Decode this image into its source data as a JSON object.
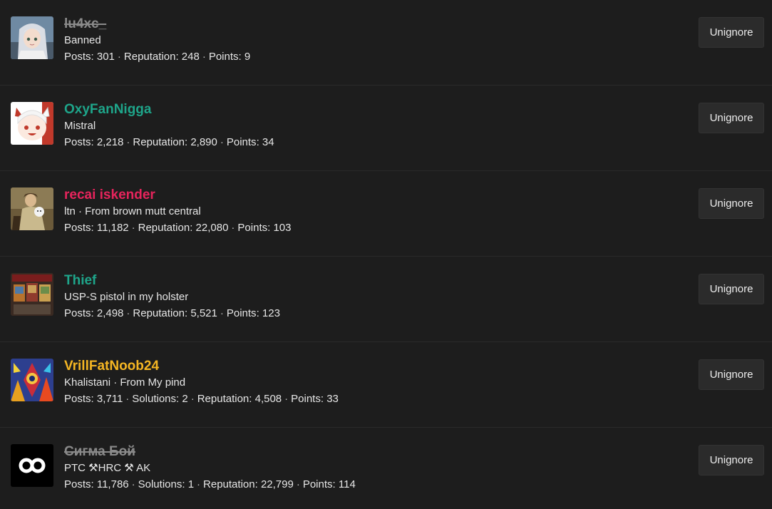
{
  "users": [
    {
      "name": "lu4xc_",
      "banned": true,
      "color": "#8a8a8a",
      "title": "Banned",
      "stats": [
        {
          "label": "Posts",
          "value": "301"
        },
        {
          "label": "Reputation",
          "value": "248"
        },
        {
          "label": "Points",
          "value": "9"
        }
      ],
      "button": "Unignore",
      "avatar": "anime-girl-avatar"
    },
    {
      "name": "OxyFanNigga",
      "banned": false,
      "color": "#1ea58a",
      "title": "Mistral",
      "stats": [
        {
          "label": "Posts",
          "value": "2,218"
        },
        {
          "label": "Reputation",
          "value": "2,890"
        },
        {
          "label": "Points",
          "value": "34"
        }
      ],
      "button": "Unignore",
      "avatar": "anime-character-avatar"
    },
    {
      "name": "recai iskender",
      "banned": false,
      "color": "#e6245c",
      "title": "ltn · From brown mutt central",
      "stats": [
        {
          "label": "Posts",
          "value": "11,182"
        },
        {
          "label": "Reputation",
          "value": "22,080"
        },
        {
          "label": "Points",
          "value": "103"
        }
      ],
      "button": "Unignore",
      "avatar": "painting-avatar"
    },
    {
      "name": "Thief",
      "banned": false,
      "color": "#1ea58a",
      "title": "USP-S pistol in my holster",
      "stats": [
        {
          "label": "Posts",
          "value": "2,498"
        },
        {
          "label": "Reputation",
          "value": "5,521"
        },
        {
          "label": "Points",
          "value": "123"
        }
      ],
      "button": "Unignore",
      "avatar": "cards-avatar"
    },
    {
      "name": "VrillFatNoob24",
      "banned": false,
      "color": "#f5b623",
      "title": "Khalistani · From My pind",
      "stats": [
        {
          "label": "Posts",
          "value": "3,711"
        },
        {
          "label": "Solutions",
          "value": "2"
        },
        {
          "label": "Reputation",
          "value": "4,508"
        },
        {
          "label": "Points",
          "value": "33"
        }
      ],
      "button": "Unignore",
      "avatar": "colorful-art-avatar"
    },
    {
      "name": "Сигма Бой",
      "banned": true,
      "color": "#8a8a8a",
      "title": "PTC ⚒HRC ⚒ AK",
      "stats": [
        {
          "label": "Posts",
          "value": "11,786"
        },
        {
          "label": "Solutions",
          "value": "1"
        },
        {
          "label": "Reputation",
          "value": "22,799"
        },
        {
          "label": "Points",
          "value": "114"
        }
      ],
      "button": "Unignore",
      "avatar": "infinity-logo-avatar"
    }
  ]
}
